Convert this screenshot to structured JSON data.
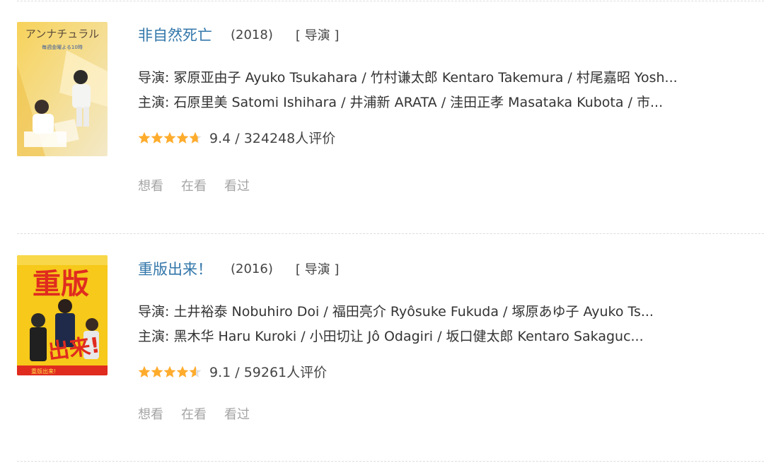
{
  "items": [
    {
      "title": "非自然死亡",
      "year": "(2018)",
      "role": "[ 导演 ]",
      "directors": "导演: 冢原亚由子 Ayuko Tsukahara / 竹村谦太郎 Kentaro Takemura / 村尾嘉昭 Yosh...",
      "cast": "主演: 石原里美 Satomi Ishihara / 井浦新 ARATA / 洼田正孝 Masataka Kubota / 市...",
      "rating": 9.4,
      "rating_text": "9.4 / 324248人评价",
      "poster": {
        "title_text": "アンナチュラル",
        "subtitle_text": "毎週金曜よる10時"
      },
      "actions": [
        "想看",
        "在看",
        "看过"
      ]
    },
    {
      "title": "重版出来！",
      "year": "(2016)",
      "role": "[ 导演 ]",
      "directors": "导演: 土井裕泰 Nobuhiro Doi / 福田亮介 Ryôsuke Fukuda / 塚原あゆ子 Ayuko Ts...",
      "cast": "主演: 黑木华 Haru Kuroki / 小田切让 Jô Odagiri / 坂口健太郎 Kentaro Sakaguc...",
      "rating": 9.1,
      "rating_text": "9.1 / 59261人评价",
      "poster": {
        "top_text": "重版",
        "bottom_text": "出来!",
        "tagline": "重版出来!"
      },
      "actions": [
        "想看",
        "在看",
        "看过"
      ]
    }
  ],
  "colors": {
    "title_link": "#3377aa",
    "star": "#ffac2d",
    "star_empty": "#e0e0e0",
    "action_text": "#a4a4a4"
  }
}
